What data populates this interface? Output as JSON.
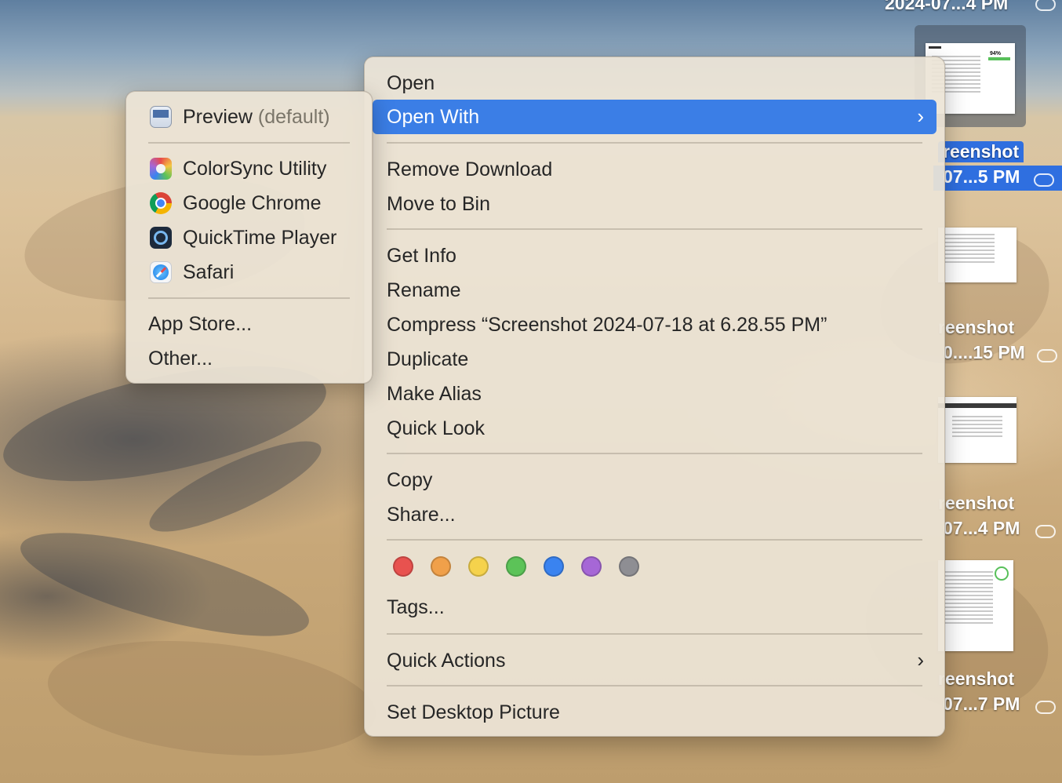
{
  "desktop": {
    "top_label": "2024-07...4 PM",
    "icons": [
      {
        "name_line1": "reenshot",
        "name_line2": "07...5 PM",
        "selected": true
      },
      {
        "name_line1": "reenshot",
        "name_line2": "0....15 PM",
        "selected": false
      },
      {
        "name_line1": "reenshot",
        "name_line2": "07...4 PM",
        "selected": false
      },
      {
        "name_line1": "reenshot",
        "name_line2": "07...7 PM",
        "selected": false
      }
    ],
    "thumb_badge": "94%"
  },
  "context_menu": {
    "items": {
      "open": "Open",
      "open_with": "Open With",
      "remove_download": "Remove Download",
      "move_to_bin": "Move to Bin",
      "get_info": "Get Info",
      "rename": "Rename",
      "compress": "Compress “Screenshot 2024-07-18 at 6.28.55 PM”",
      "duplicate": "Duplicate",
      "make_alias": "Make Alias",
      "quick_look": "Quick Look",
      "copy": "Copy",
      "share": "Share...",
      "tags": "Tags...",
      "quick_actions": "Quick Actions",
      "set_desktop_picture": "Set Desktop Picture"
    },
    "chevron": "›",
    "tag_colors": [
      "#e8524f",
      "#f0a04a",
      "#f5d24c",
      "#5cc358",
      "#3a83f0",
      "#a667d6",
      "#8e8e93"
    ]
  },
  "open_with_menu": {
    "default_app": "Preview",
    "default_suffix": "(default)",
    "apps": [
      "ColorSync Utility",
      "Google Chrome",
      "QuickTime Player",
      "Safari"
    ],
    "app_store": "App Store...",
    "other": "Other..."
  },
  "colors": {
    "highlight": "#3b7ee6",
    "selection": "#2f6fe0"
  }
}
